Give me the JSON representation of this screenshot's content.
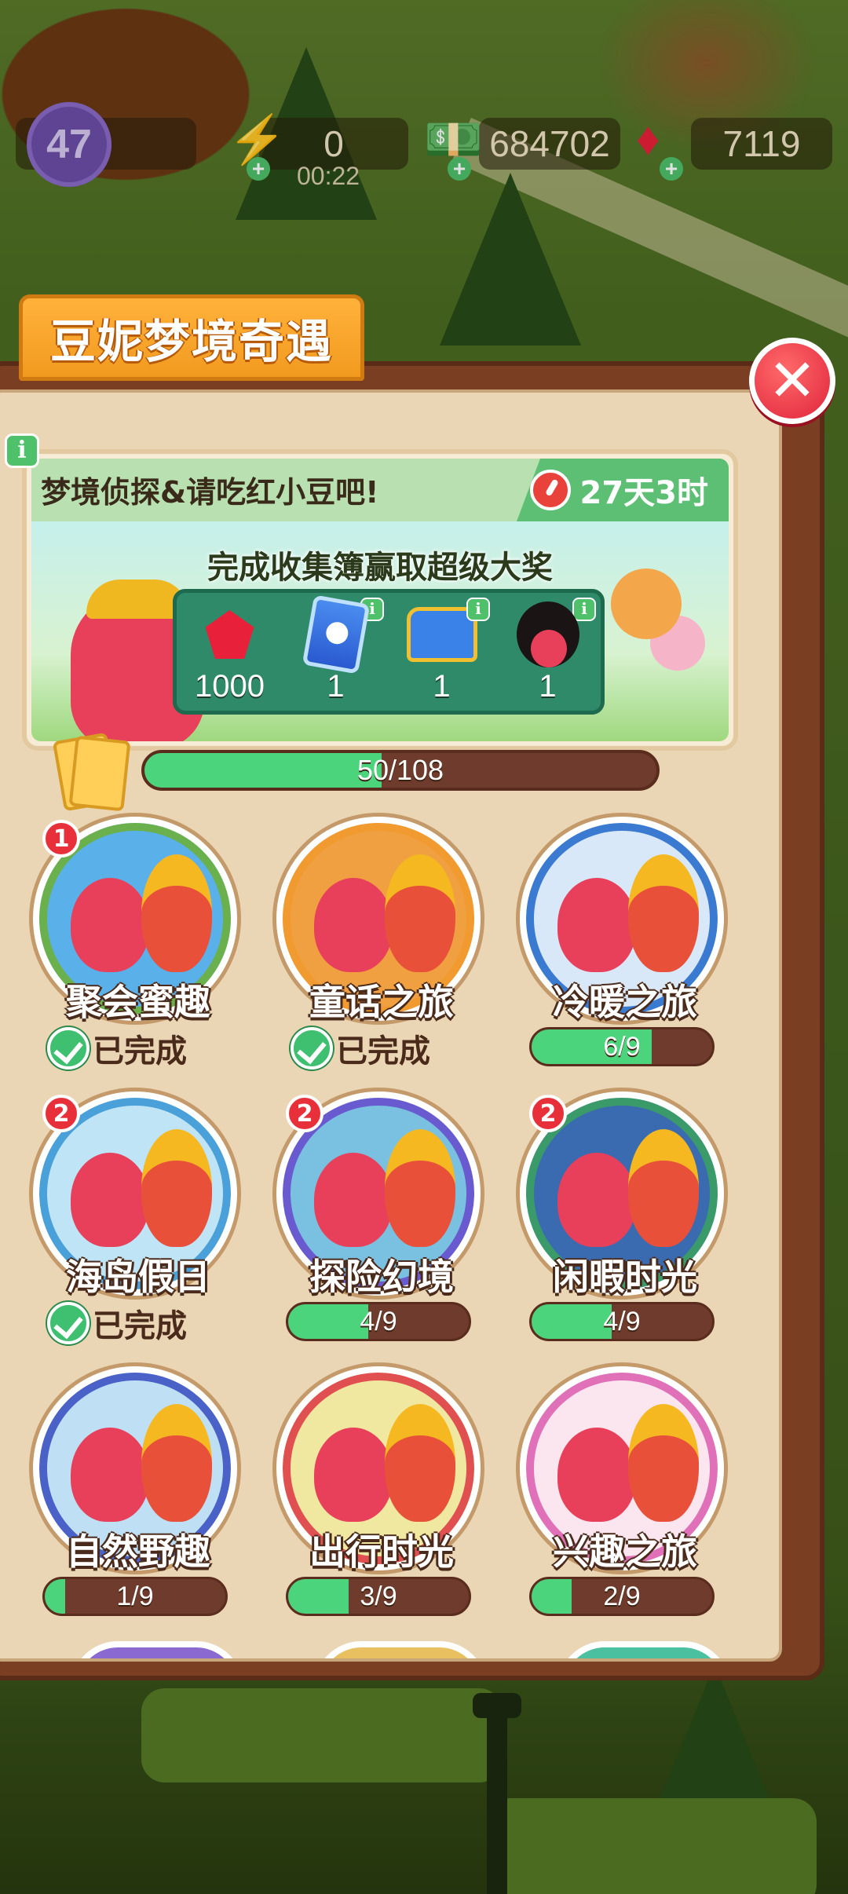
{
  "hud": {
    "level": "47",
    "energy": "0",
    "energy_timer": "00:22",
    "cash": "684702",
    "gems": "7119"
  },
  "panel": {
    "title": "豆妮梦境奇遇",
    "close_icon": "close-icon"
  },
  "banner": {
    "title": "梦境侦探&请吃红小豆吧!",
    "time_left": "27天3时",
    "subtitle": "完成收集簿赢取超级大奖",
    "rewards": [
      {
        "icon": "ruby-gem-icon",
        "qty": "1000"
      },
      {
        "icon": "upgrade-card-icon",
        "qty": "1"
      },
      {
        "icon": "treasure-chest-icon",
        "qty": "1"
      },
      {
        "icon": "avatar-frame-icon",
        "qty": "1"
      }
    ]
  },
  "collection": {
    "progress_text": "50/108",
    "progress_value": 0.463
  },
  "albums": [
    {
      "name": "聚会蜜趣",
      "badge": "1",
      "status": "已完成",
      "completed": true,
      "progress_value": 1.0,
      "ring": "#6ab04c",
      "bg": "#5ab0e8"
    },
    {
      "name": "童话之旅",
      "badge": "",
      "status": "已完成",
      "completed": true,
      "progress_value": 1.0,
      "ring": "#f09a30",
      "bg": "#f0a040"
    },
    {
      "name": "冷暖之旅",
      "badge": "",
      "progress_text": "6/9",
      "completed": false,
      "progress_value": 0.667,
      "ring": "#3a7ad0",
      "bg": "#d8e8f8"
    },
    {
      "name": "海岛假日",
      "badge": "2",
      "status": "已完成",
      "completed": true,
      "progress_value": 1.0,
      "ring": "#4aa0d8",
      "bg": "#bfe4f6"
    },
    {
      "name": "探险幻境",
      "badge": "2",
      "progress_text": "4/9",
      "completed": false,
      "progress_value": 0.444,
      "ring": "#6a5ad0",
      "bg": "#7ac0e0"
    },
    {
      "name": "闲暇时光",
      "badge": "2",
      "progress_text": "4/9",
      "completed": false,
      "progress_value": 0.444,
      "ring": "#3a9a6a",
      "bg": "#3a6ab0"
    },
    {
      "name": "自然野趣",
      "badge": "",
      "progress_text": "1/9",
      "completed": false,
      "progress_value": 0.111,
      "ring": "#4a62c8",
      "bg": "#bfe0f4"
    },
    {
      "name": "出行时光",
      "badge": "",
      "progress_text": "3/9",
      "completed": false,
      "progress_value": 0.333,
      "ring": "#e05050",
      "bg": "#f0e8a0"
    },
    {
      "name": "兴趣之旅",
      "badge": "",
      "progress_text": "2/9",
      "completed": false,
      "progress_value": 0.222,
      "ring": "#e070b8",
      "bg": "#fbe6f0"
    }
  ],
  "colors": {
    "accent_green": "#4bd47c",
    "bar_track": "#6e3b2c",
    "tab_orange": "#f29a20",
    "close_red": "#e0243b"
  }
}
